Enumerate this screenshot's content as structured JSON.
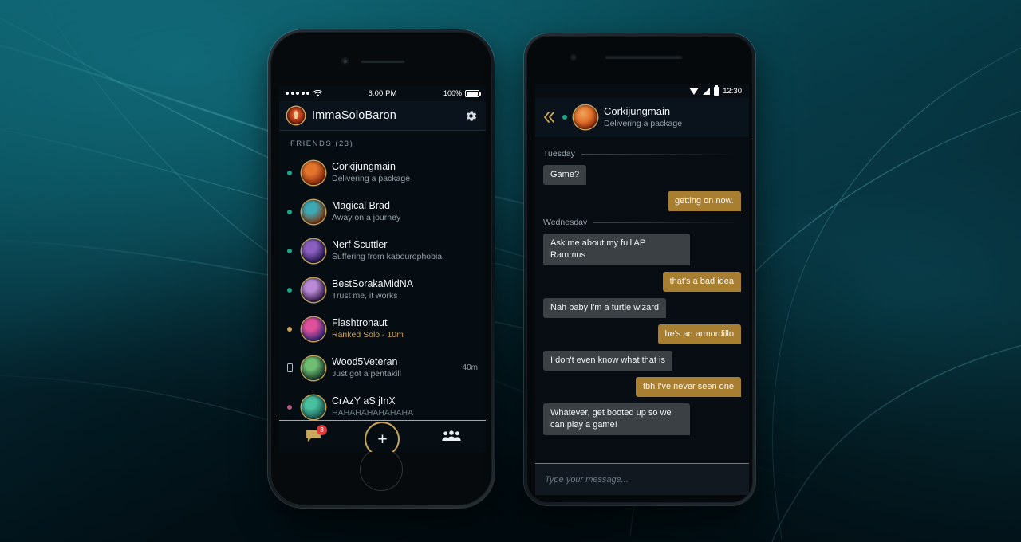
{
  "background": {
    "base_color": "#04161c",
    "accent_color": "#0d6b7a"
  },
  "left_phone": {
    "device": "iphone",
    "status_bar": {
      "signal_dots": 5,
      "wifi_icon": "wifi-icon",
      "time": "6:00 PM",
      "battery_percent": "100%",
      "battery_icon": "battery-icon"
    },
    "header": {
      "crest_icon": "summoner-crest-icon",
      "username": "ImmaSoloBaron",
      "settings_icon": "gear-icon"
    },
    "section_label": "FRIENDS (23)",
    "friends": [
      {
        "name": "Corkijungmain",
        "status_text": "Delivering a package",
        "status_type": "online",
        "status_color": "#1ba888",
        "avatar_color_a": "#e3742c",
        "avatar_color_b": "#8d2c10",
        "time": ""
      },
      {
        "name": "Magical Brad",
        "status_text": "Away on a journey",
        "status_type": "online",
        "status_color": "#1ba888",
        "avatar_color_a": "#3fa8b5",
        "avatar_color_b": "#7a3e1c",
        "time": ""
      },
      {
        "name": "Nerf Scuttler",
        "status_text": "Suffering from kabourophobia",
        "status_type": "online",
        "status_color": "#1ba888",
        "avatar_color_a": "#8a5fc0",
        "avatar_color_b": "#2a1a52",
        "time": ""
      },
      {
        "name": "BestSorakaMidNA",
        "status_text": "Trust me, it works",
        "status_type": "online",
        "status_color": "#1ba888",
        "avatar_color_a": "#b98ad6",
        "avatar_color_b": "#3b2150",
        "time": ""
      },
      {
        "name": "Flashtronaut",
        "status_text": "Ranked Solo - 10m",
        "status_type": "in-game",
        "status_color": "#c9a55a",
        "avatar_color_a": "#e0509b",
        "avatar_color_b": "#3a2a78",
        "time": ""
      },
      {
        "name": "Wood5Veteran",
        "status_text": "Just got a pentakill",
        "status_type": "mobile",
        "status_color": "#aab6bd",
        "avatar_color_a": "#6fbf73",
        "avatar_color_b": "#1f4430",
        "time": "40m"
      },
      {
        "name": "CrAzY aS jInX",
        "status_text": "HAHAHAHAHAHAHA",
        "status_type": "away",
        "status_color": "#b05a86",
        "avatar_color_a": "#49c0a0",
        "avatar_color_b": "#1d5a53",
        "time": ""
      }
    ],
    "nav": {
      "chat_icon": "chat-bubble-icon",
      "chat_badge": "3",
      "add_icon": "plus-icon",
      "friends_icon": "group-people-icon"
    }
  },
  "right_phone": {
    "device": "android",
    "status_bar": {
      "wifi_icon": "wifi-icon",
      "signal_icon": "signal-icon",
      "battery_icon": "battery-icon",
      "time": "12:30"
    },
    "header": {
      "back_icon": "back-chevron-icon",
      "status_color": "#1ba888",
      "avatar_icon": "avatar-icon",
      "name": "Corkijungmain",
      "status_text": "Delivering a package"
    },
    "thread": [
      {
        "kind": "day",
        "label": "Tuesday"
      },
      {
        "kind": "message",
        "direction": "in",
        "text": "Game?"
      },
      {
        "kind": "message",
        "direction": "out",
        "text": "getting on now."
      },
      {
        "kind": "day",
        "label": "Wednesday"
      },
      {
        "kind": "message",
        "direction": "in",
        "text": "Ask me about my full AP Rammus"
      },
      {
        "kind": "message",
        "direction": "out",
        "text": "that's a bad idea"
      },
      {
        "kind": "message",
        "direction": "in",
        "text": "Nah baby I'm a turtle wizard"
      },
      {
        "kind": "message",
        "direction": "out",
        "text": "he's an armordillo"
      },
      {
        "kind": "message",
        "direction": "in",
        "text": "I don't even know what that is"
      },
      {
        "kind": "message",
        "direction": "out",
        "text": "tbh I've never seen one"
      },
      {
        "kind": "message",
        "direction": "in",
        "text": "Whatever, get booted up so we can play a game!"
      }
    ],
    "composer": {
      "placeholder": "Type your message...",
      "value": ""
    }
  },
  "colors": {
    "gold": "#c9a55a",
    "bubble_in": "#3b4045",
    "bubble_out": "#a87e31",
    "panel": "#0a131b",
    "screen": "#050c12"
  }
}
